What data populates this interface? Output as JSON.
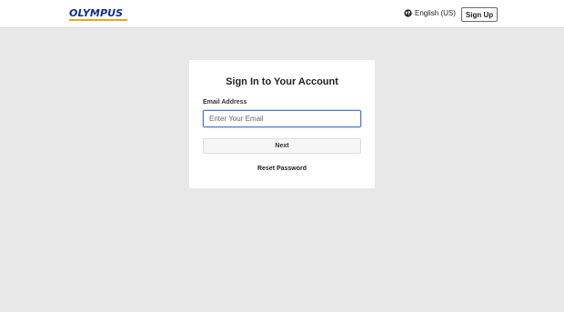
{
  "header": {
    "logo_text": "OLYMPUS",
    "language": {
      "label": "English (US)",
      "icon": "globe-icon",
      "chevron_icon": "chevron-down-icon"
    },
    "signup_label": "Sign Up"
  },
  "card": {
    "title": "Sign In to Your Account",
    "email_label": "Email Address",
    "email_placeholder": "Enter Your Email",
    "email_value": "",
    "next_label": "Next",
    "reset_label": "Reset Password"
  },
  "colors": {
    "brand_blue": "#0b2f8f",
    "brand_accent": "#e3a81b",
    "page_background": "#e8e8e8",
    "input_focus": "#4a78c8"
  }
}
